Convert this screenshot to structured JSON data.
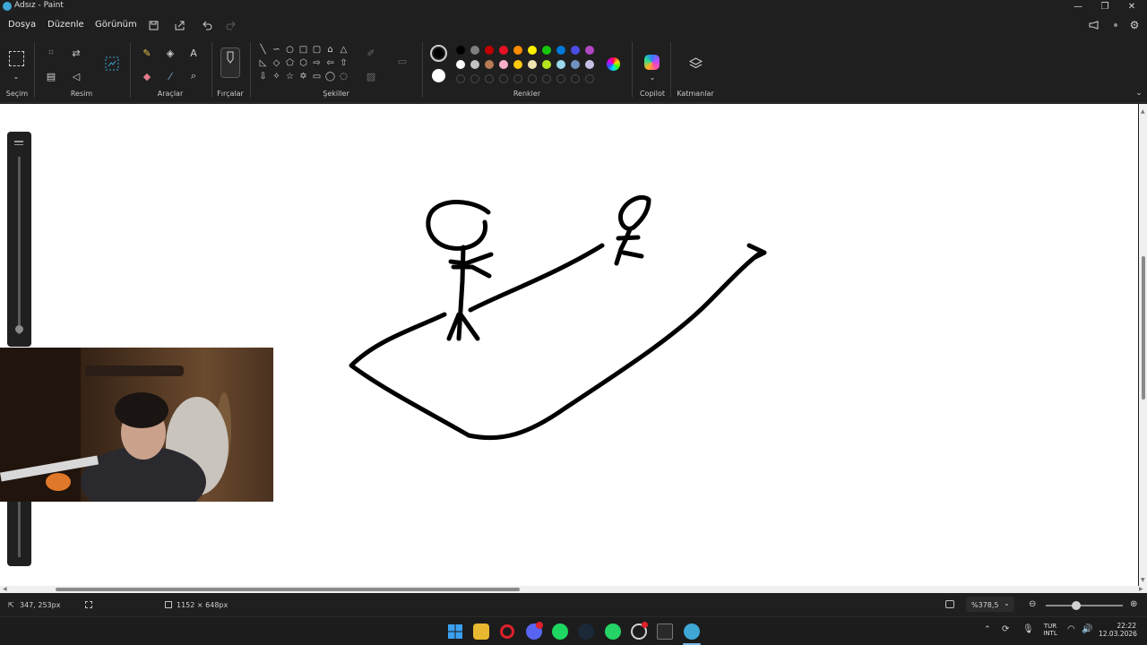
{
  "window": {
    "title": "Adsız - Paint",
    "minimize_glyph": "—",
    "restore_glyph": "❐",
    "close_glyph": "✕"
  },
  "menu": {
    "items": [
      "Dosya",
      "Düzenle",
      "Görünüm"
    ]
  },
  "ribbon": {
    "groups": {
      "selection": "Seçim",
      "image": "Resim",
      "tools": "Araçlar",
      "brushes": "Fırçalar",
      "shapes": "Şekiller",
      "colors": "Renkler",
      "copilot": "Copilot",
      "layers": "Katmanlar"
    },
    "text_tool_glyph": "A",
    "palette_row1": [
      "#000000",
      "#7f7f7f",
      "#c00000",
      "#e81123",
      "#ff8c00",
      "#fff100",
      "#16c60c",
      "#0078d7",
      "#4c4ce6",
      "#b146c2"
    ],
    "palette_row2": [
      "#ffffff",
      "#c3c3c3",
      "#b97a57",
      "#ffaec9",
      "#ffc90e",
      "#efe4b0",
      "#b5e61d",
      "#99d9ea",
      "#7092be",
      "#c8bfe7"
    ],
    "primary_color": "#000000",
    "secondary_color": "#ffffff"
  },
  "status": {
    "cursor_position": "347, 253px",
    "canvas_size": "1152 × 648px",
    "zoom": "%378,5"
  },
  "taskbar": {
    "language_line1": "TUR",
    "language_line2": "INTL",
    "time": "22:22",
    "date": "12.03.2026",
    "apps": [
      "windows-start",
      "file-explorer",
      "opera",
      "discord",
      "spotify",
      "steam",
      "whatsapp",
      "xbox",
      "epic-games",
      "paint"
    ]
  }
}
